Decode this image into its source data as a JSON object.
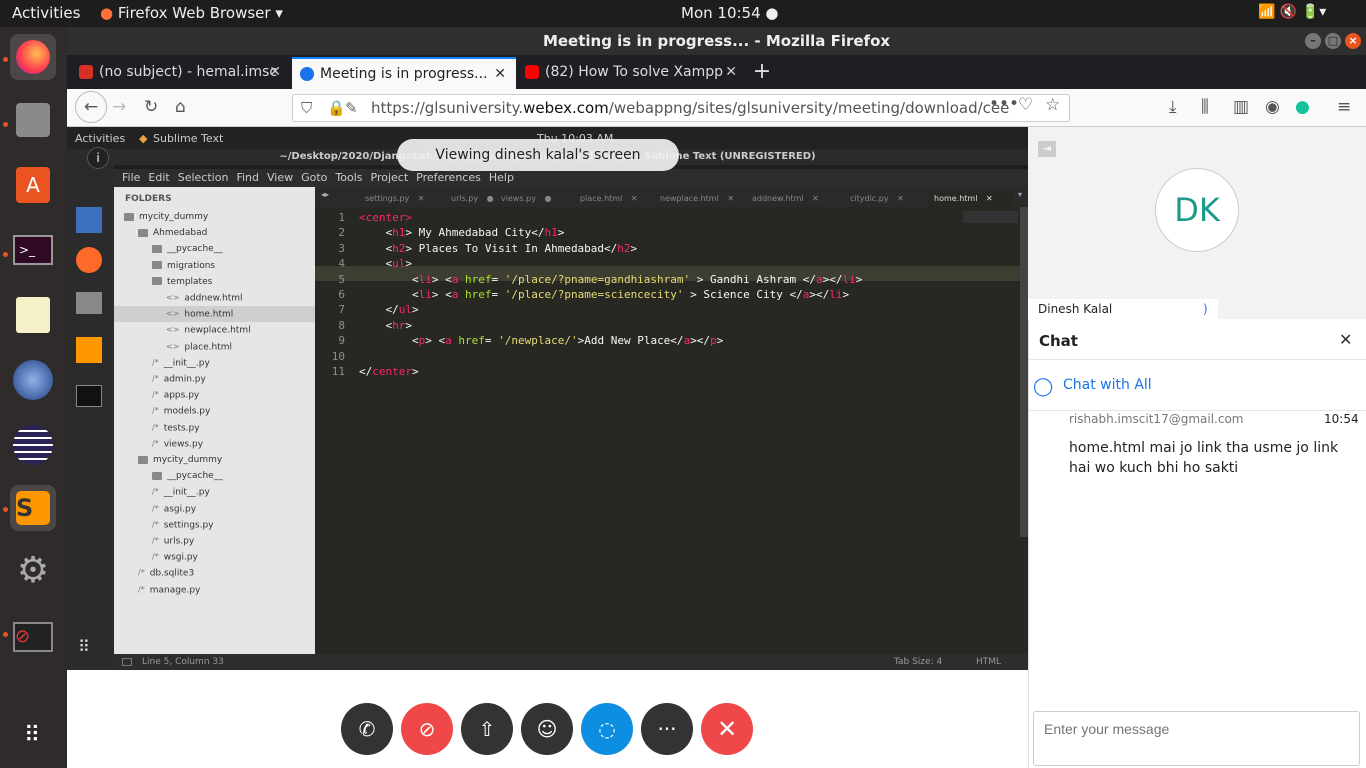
{
  "topbar": {
    "activities": "Activities",
    "app": "Firefox Web Browser",
    "clock": "Mon 10:54"
  },
  "window": {
    "title": "Meeting is in progress... - Mozilla Firefox"
  },
  "tabs": [
    {
      "label": "(no subject) - hemal.imsc",
      "icon_color": "#d93025"
    },
    {
      "label": "Meeting is in progress...",
      "icon_color": "#1a73e8"
    },
    {
      "label": "(82) How To solve Xampp",
      "icon_color": "#ff0000"
    }
  ],
  "url": {
    "prefix": "https://glsuniversity.",
    "domain": "webex.com",
    "path": "/webappng/sites/glsuniversity/meeting/download/cee"
  },
  "shared": {
    "toast": "Viewing dinesh kalal's screen",
    "inner_activities": "Activities",
    "inner_app": "Sublime Text",
    "inner_clock": "Thu 10:03 AM",
    "sublime_title": "~/Desktop/2020/DjangoLab/mycity_dummy/... (mycity_dummy) - Sublime Text (UNREGISTERED)",
    "menu": [
      "File",
      "Edit",
      "Selection",
      "Find",
      "View",
      "Goto",
      "Tools",
      "Project",
      "Preferences",
      "Help"
    ],
    "folders_label": "FOLDERS",
    "tree": [
      {
        "t": "mycity_dummy",
        "d": 0,
        "f": true
      },
      {
        "t": "Ahmedabad",
        "d": 1,
        "f": true
      },
      {
        "t": "__pycache__",
        "d": 2,
        "f": true
      },
      {
        "t": "migrations",
        "d": 2,
        "f": true
      },
      {
        "t": "templates",
        "d": 2,
        "f": true
      },
      {
        "t": "addnew.html",
        "d": 3,
        "f": false
      },
      {
        "t": "home.html",
        "d": 3,
        "f": false
      },
      {
        "t": "newplace.html",
        "d": 3,
        "f": false
      },
      {
        "t": "place.html",
        "d": 3,
        "f": false
      },
      {
        "t": "__init__.py",
        "d": 2,
        "f": false
      },
      {
        "t": "admin.py",
        "d": 2,
        "f": false
      },
      {
        "t": "apps.py",
        "d": 2,
        "f": false
      },
      {
        "t": "models.py",
        "d": 2,
        "f": false
      },
      {
        "t": "tests.py",
        "d": 2,
        "f": false
      },
      {
        "t": "views.py",
        "d": 2,
        "f": false
      },
      {
        "t": "mycity_dummy",
        "d": 1,
        "f": true
      },
      {
        "t": "__pycache__",
        "d": 2,
        "f": true
      },
      {
        "t": "__init__.py",
        "d": 2,
        "f": false
      },
      {
        "t": "asgi.py",
        "d": 2,
        "f": false
      },
      {
        "t": "settings.py",
        "d": 2,
        "f": false
      },
      {
        "t": "urls.py",
        "d": 2,
        "f": false
      },
      {
        "t": "wsgi.py",
        "d": 2,
        "f": false
      },
      {
        "t": "db.sqlite3",
        "d": 1,
        "f": false
      },
      {
        "t": "manage.py",
        "d": 1,
        "f": false
      }
    ],
    "editor_tabs": [
      "settings.py",
      "urls.py",
      "views.py",
      "place.html",
      "newplace.html",
      "addnew.html",
      "citydic.py",
      "home.html"
    ],
    "status_left": "Line 5, Column 33",
    "status_tab": "Tab Size: 4",
    "status_syntax": "HTML"
  },
  "participant": {
    "initials": "DK",
    "name": "Dinesh Kalal"
  },
  "chat": {
    "title": "Chat",
    "chat_with": "Chat with All",
    "sender": "rishabh.imscit17@gmail.com",
    "time": "10:54",
    "message": "home.html mai jo link tha usme jo link hai wo kuch bhi ho sakti",
    "placeholder": "Enter your message"
  }
}
